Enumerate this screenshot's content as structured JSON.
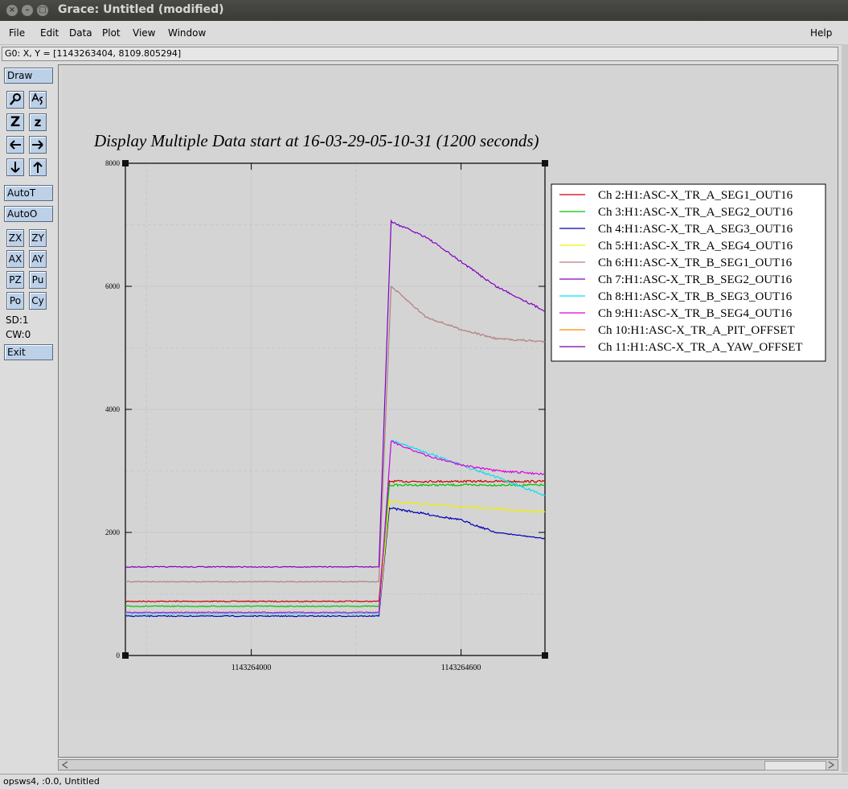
{
  "window": {
    "title": "Grace: Untitled (modified)"
  },
  "menu": {
    "file": "File",
    "edit": "Edit",
    "data": "Data",
    "plot": "Plot",
    "view": "View",
    "window": "Window",
    "help": "Help"
  },
  "locator": "G0: X, Y = [1143263404, 8109.805294]",
  "tools": {
    "draw": "Draw",
    "zoom_glyph": "Z",
    "zoom_small_glyph": "z",
    "autot": "AutoT",
    "autoo": "AutoO",
    "zx": "ZX",
    "zy": "ZY",
    "ax": "AX",
    "ay": "AY",
    "pz": "PZ",
    "pu": "Pu",
    "po": "Po",
    "cy": "Cy",
    "sd": "SD:1",
    "cw": "CW:0",
    "exit": "Exit"
  },
  "status": "opsws4, :0.0, Untitled",
  "chart_data": {
    "type": "line",
    "title": "Display Multiple Data start at 16-03-29-05-10-31 (1200 seconds)",
    "xlim": [
      1143263640,
      1143264840
    ],
    "ylim": [
      0,
      8000
    ],
    "xticks": [
      1143264000,
      1143264600
    ],
    "yticks": [
      0,
      2000,
      4000,
      6000,
      8000
    ],
    "grid": true,
    "legend_position": "top-right",
    "series": [
      {
        "name": "Ch 2:H1:ASC-X_TR_A_SEG1_OUT16",
        "color": "#cc0000",
        "x": [
          1143263640,
          1143264365,
          1143264395,
          1143264840
        ],
        "y": [
          880,
          880,
          2830,
          2830
        ]
      },
      {
        "name": "Ch 3:H1:ASC-X_TR_A_SEG2_OUT16",
        "color": "#00c000",
        "x": [
          1143263640,
          1143264365,
          1143264395,
          1143264840
        ],
        "y": [
          800,
          800,
          2770,
          2770
        ]
      },
      {
        "name": "Ch 4:H1:ASC-X_TR_A_SEG3_OUT16",
        "color": "#0000b0",
        "x": [
          1143263640,
          1143264365,
          1143264395,
          1143264500,
          1143264600,
          1143264700,
          1143264840
        ],
        "y": [
          640,
          640,
          2400,
          2300,
          2200,
          2000,
          1900
        ]
      },
      {
        "name": "Ch 5:H1:ASC-X_TR_A_SEG4_OUT16",
        "color": "#f0f000",
        "x": [
          1143263640,
          1143264365,
          1143264395,
          1143264600,
          1143264840
        ],
        "y": [
          700,
          700,
          2500,
          2420,
          2330
        ]
      },
      {
        "name": "Ch 6:H1:ASC-X_TR_B_SEG1_OUT16",
        "color": "#b08080",
        "x": [
          1143263640,
          1143264365,
          1143264400,
          1143264500,
          1143264600,
          1143264700,
          1143264840
        ],
        "y": [
          1200,
          1200,
          6000,
          5500,
          5300,
          5150,
          5100
        ]
      },
      {
        "name": "Ch 7:H1:ASC-X_TR_B_SEG2_OUT16",
        "color": "#8000c0",
        "x": [
          1143263640,
          1143264365,
          1143264400,
          1143264500,
          1143264600,
          1143264700,
          1143264840
        ],
        "y": [
          1440,
          1440,
          7050,
          6800,
          6400,
          6000,
          5600
        ]
      },
      {
        "name": "Ch 8:H1:ASC-X_TR_B_SEG3_OUT16",
        "color": "#00e0f0",
        "x": [
          1143263640,
          1143264365,
          1143264400,
          1143264500,
          1143264600,
          1143264700,
          1143264840
        ],
        "y": [
          680,
          680,
          3500,
          3300,
          3100,
          2900,
          2600
        ]
      },
      {
        "name": "Ch 9:H1:ASC-X_TR_B_SEG4_OUT16",
        "color": "#e000e0",
        "x": [
          1143263640,
          1143264365,
          1143264400,
          1143264500,
          1143264600,
          1143264700,
          1143264840
        ],
        "y": [
          700,
          700,
          3480,
          3250,
          3100,
          3000,
          2950
        ]
      },
      {
        "name": "Ch 10:H1:ASC-X_TR_A_PIT_OFFSET",
        "color": "#ff8c00",
        "x": [],
        "y": []
      },
      {
        "name": "Ch 11:H1:ASC-X_TR_A_YAW_OFFSET",
        "color": "#7000a0",
        "x": [],
        "y": []
      }
    ]
  }
}
